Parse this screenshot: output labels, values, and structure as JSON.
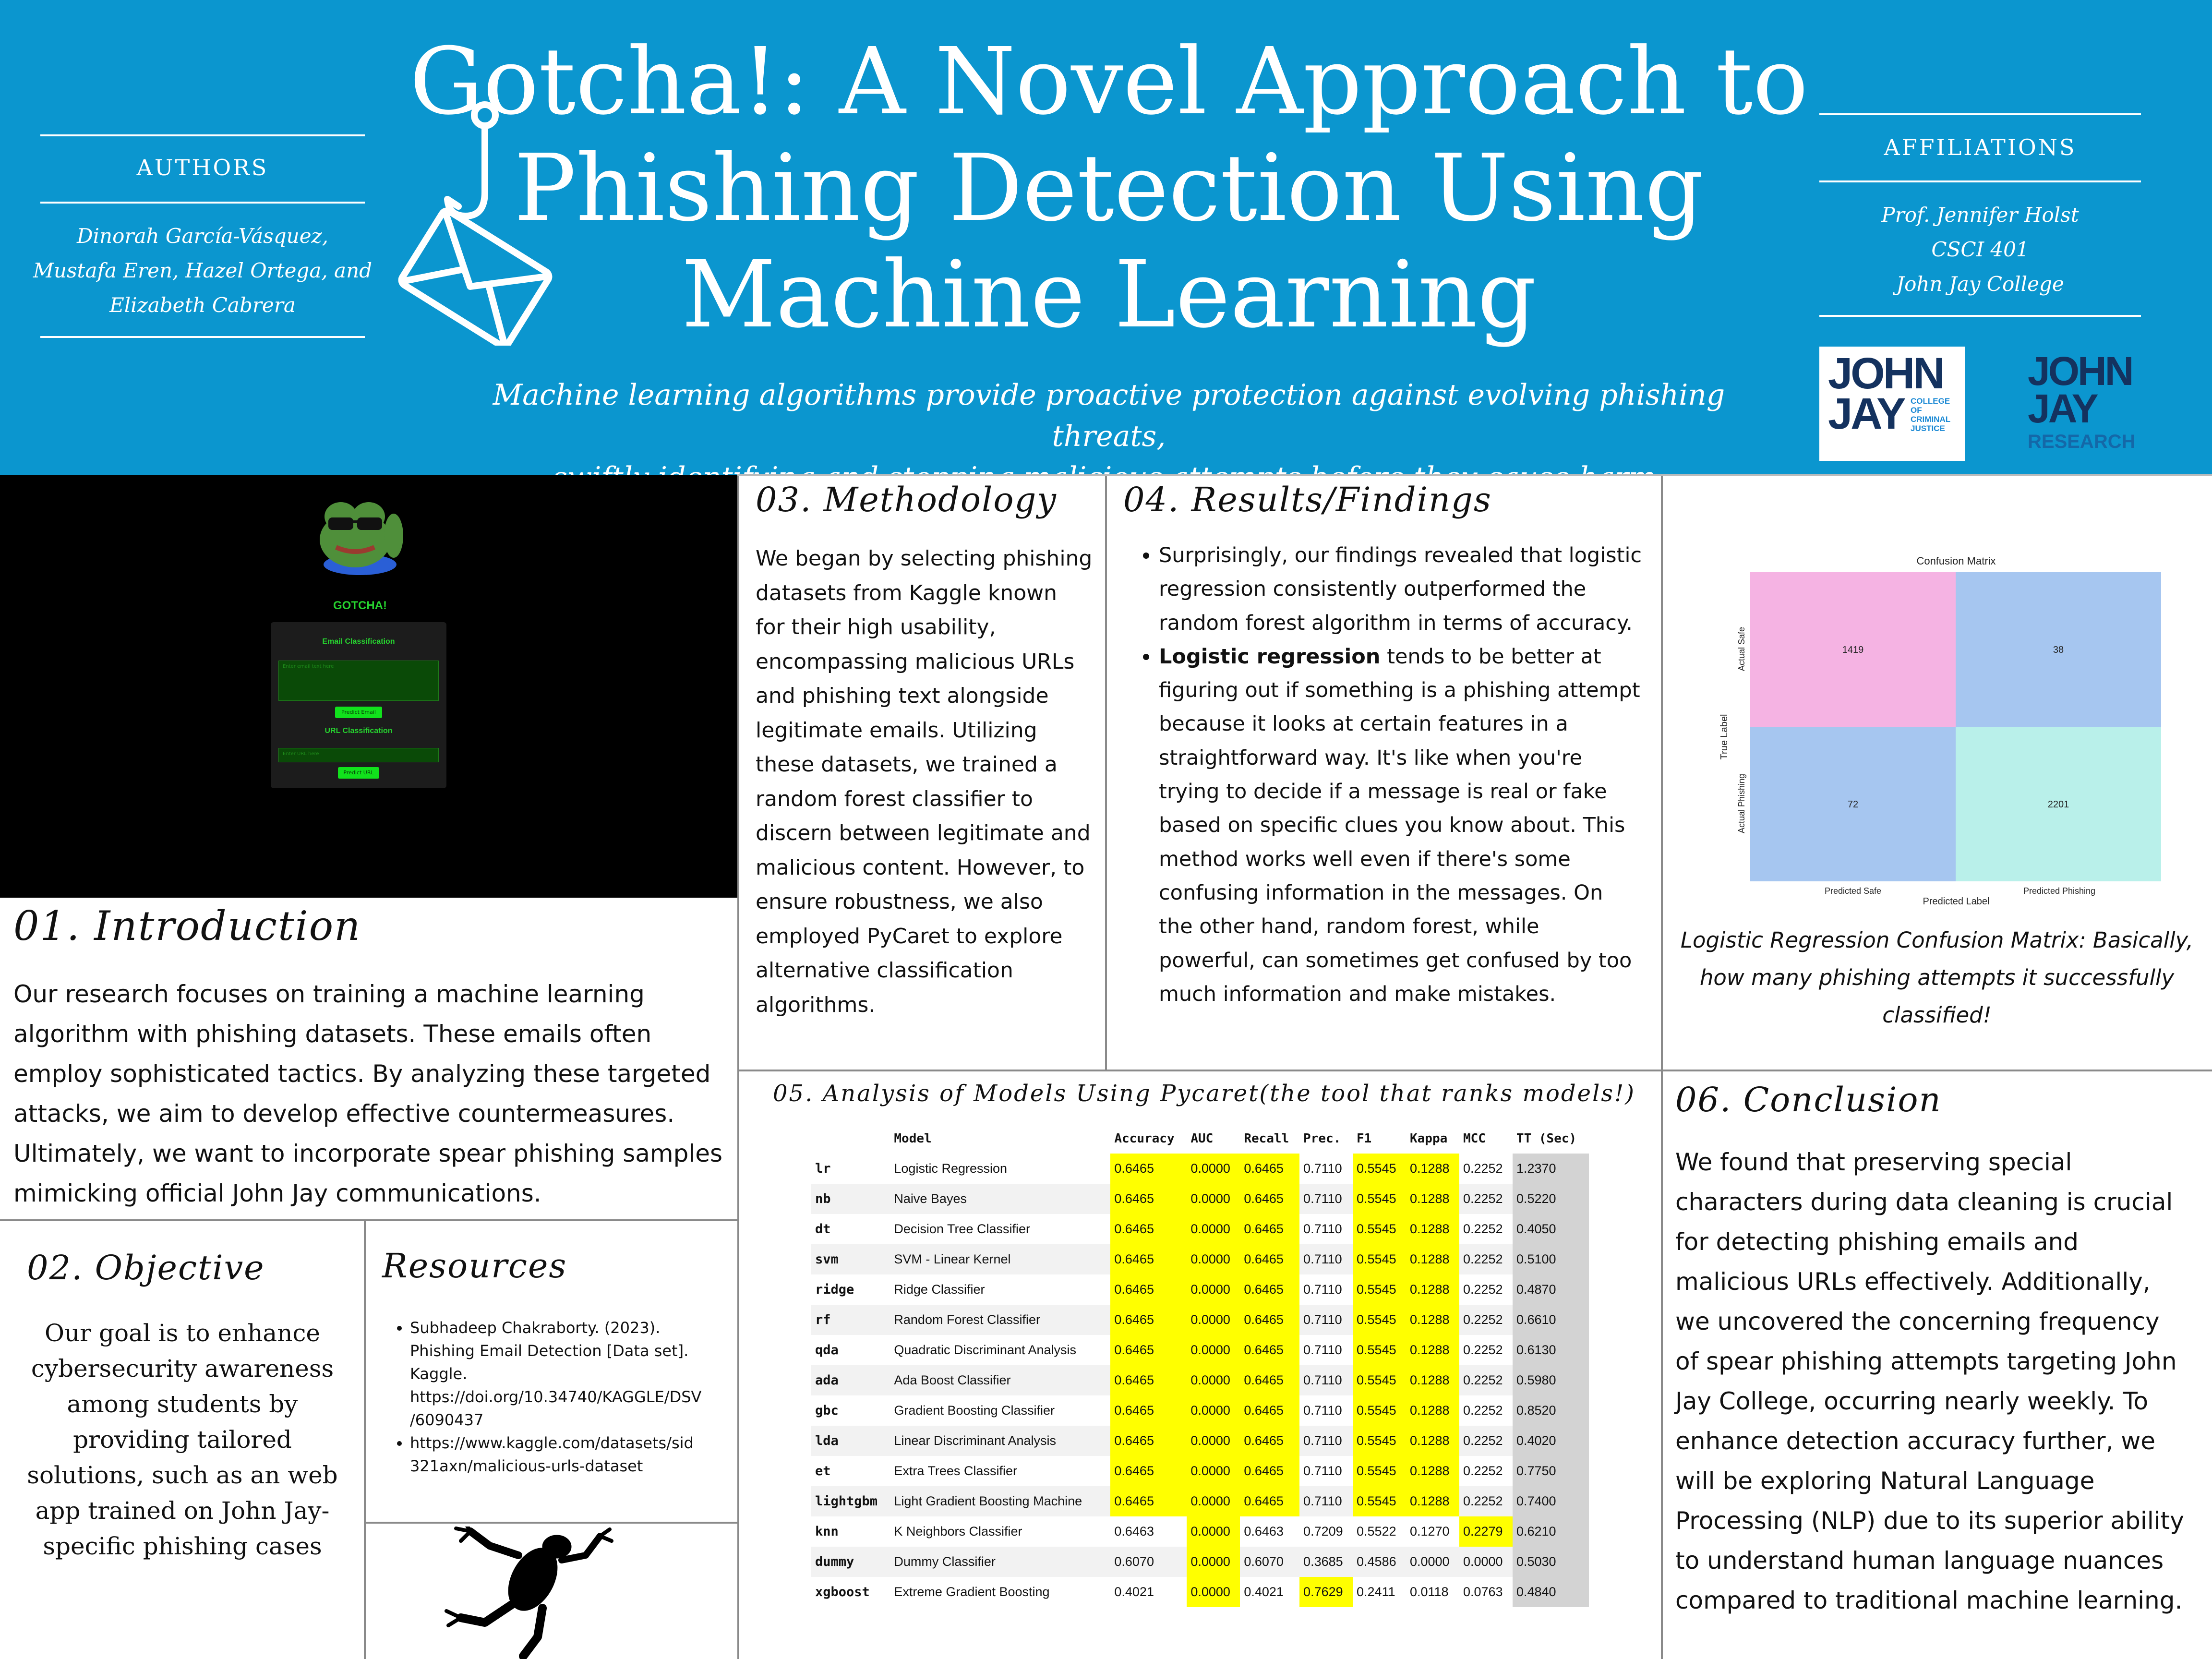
{
  "header": {
    "title_lines": [
      "Gotcha!: A Novel Approach to",
      "Phishing Detection Using",
      "Machine Learning"
    ],
    "tagline_lines": [
      "Machine learning algorithms provide proactive protection against evolving phishing threats,",
      "swiftly identifying and stopping malicious attempts before they cause harm."
    ],
    "authors_label": "AUTHORS",
    "authors_lines": [
      "Dinorah García-Vásquez,",
      "Mustafa Eren, Hazel Ortega, and",
      "Elizabeth Cabrera"
    ],
    "affiliations_label": "AFFILIATIONS",
    "affiliations_lines": [
      "Prof. Jennifer Holst",
      "CSCI 401",
      "John Jay College"
    ],
    "logo1": {
      "line1": "JOHN",
      "line2": "JAY",
      "sub": [
        "COLLEGE",
        "OF",
        "CRIMINAL",
        "JUSTICE"
      ]
    },
    "logo2": {
      "line1": "JOHN",
      "line2": "JAY",
      "sub": "RESEARCH"
    },
    "icon": "phishing-hook-envelope-icon"
  },
  "app_mockup": {
    "brand": "GOTCHA!",
    "email_heading": "Email Classification",
    "email_placeholder": "Enter email text here",
    "email_button": "Predict Email",
    "url_heading": "URL Classification",
    "url_placeholder": "Enter URL here",
    "url_button": "Predict URL",
    "mascot": "frog-with-sunglasses-icon"
  },
  "introduction": {
    "title": "01. Introduction",
    "lines": [
      "Our research focuses on training a machine learning",
      "algorithm with phishing datasets. These emails often",
      "employ sophisticated tactics. By analyzing these targeted",
      "attacks, we aim to develop effective countermeasures.",
      "Ultimately, we want to incorporate spear phishing samples",
      "mimicking official John Jay communications."
    ]
  },
  "objective": {
    "title": "02. Objective",
    "lines": [
      "Our goal is to enhance",
      "cybersecurity awareness",
      "among students by",
      "providing tailored",
      "solutions, such as an web",
      "app trained on John Jay-",
      "specific phishing cases"
    ]
  },
  "resources": {
    "title": "Resources",
    "items": [
      [
        "Subhadeep Chakraborty. (2023).",
        "Phishing Email Detection [Data set].",
        "Kaggle.",
        "https://doi.org/10.34740/KAGGLE/DSV",
        "/6090437"
      ],
      [
        "https://www.kaggle.com/datasets/sid",
        "321axn/malicious-urls-dataset"
      ]
    ],
    "decoration": "frog-silhouette-icon"
  },
  "methodology": {
    "title": "03. Methodology",
    "lines": [
      "We began by selecting phishing",
      "datasets from Kaggle known",
      "for their high usability,",
      "encompassing malicious URLs",
      "and phishing text alongside",
      "legitimate emails. Utilizing",
      "these datasets, we trained a",
      "random forest classifier to",
      "discern between legitimate and",
      "malicious content. However, to",
      "ensure robustness, we also",
      "employed PyCaret to explore",
      "alternative classification",
      "algorithms."
    ]
  },
  "results": {
    "title": "04. Results/Findings",
    "bullet1": [
      "Surprisingly, our findings revealed that logistic",
      "regression consistently outperformed the",
      "random forest algorithm in terms of accuracy."
    ],
    "bullet2_bold": "Logistic regression",
    "bullet2_first_rest": " tends to be better at",
    "bullet2": [
      "figuring out if something is a phishing attempt",
      "because it looks at certain features in a",
      "straightforward way. It's like when you're",
      "trying to decide if a message is real or fake",
      "based on specific clues you know about. This",
      "method works well even if there's some",
      "confusing information in the messages. On",
      "the other hand, random forest, while",
      "powerful, can sometimes get confused by too",
      "much information and make mistakes."
    ]
  },
  "confusion": {
    "caption_lines": [
      "Logistic Regression Confusion Matrix: Basically,",
      "how many phishing attempts it successfully",
      "classified!"
    ]
  },
  "chart_data": {
    "type": "heatmap",
    "title": "Confusion Matrix",
    "xlabel": "Predicted Label",
    "ylabel": "True Label",
    "x_categories": [
      "Predicted Safe",
      "Predicted Phishing"
    ],
    "y_categories": [
      "Actual Safe",
      "Actual Phishing"
    ],
    "values": [
      [
        1419,
        38
      ],
      [
        72,
        2201
      ]
    ],
    "colors": [
      [
        "#f5b3e3",
        "#a6c6f0"
      ],
      [
        "#a6c6f0",
        "#b9f0ea"
      ]
    ]
  },
  "analysis": {
    "title": "05. Analysis of Models Using Pycaret(the tool that ranks models!)",
    "headers": [
      "",
      "Model",
      "Accuracy",
      "AUC",
      "Recall",
      "Prec.",
      "F1",
      "Kappa",
      "MCC",
      "TT (Sec)"
    ],
    "rows": [
      [
        "lr",
        "Logistic Regression",
        "0.6465",
        "0.0000",
        "0.6465",
        "0.7110",
        "0.5545",
        "0.1288",
        "0.2252",
        "1.2370"
      ],
      [
        "nb",
        "Naive Bayes",
        "0.6465",
        "0.0000",
        "0.6465",
        "0.7110",
        "0.5545",
        "0.1288",
        "0.2252",
        "0.5220"
      ],
      [
        "dt",
        "Decision Tree Classifier",
        "0.6465",
        "0.0000",
        "0.6465",
        "0.7110",
        "0.5545",
        "0.1288",
        "0.2252",
        "0.4050"
      ],
      [
        "svm",
        "SVM - Linear Kernel",
        "0.6465",
        "0.0000",
        "0.6465",
        "0.7110",
        "0.5545",
        "0.1288",
        "0.2252",
        "0.5100"
      ],
      [
        "ridge",
        "Ridge Classifier",
        "0.6465",
        "0.0000",
        "0.6465",
        "0.7110",
        "0.5545",
        "0.1288",
        "0.2252",
        "0.4870"
      ],
      [
        "rf",
        "Random Forest Classifier",
        "0.6465",
        "0.0000",
        "0.6465",
        "0.7110",
        "0.5545",
        "0.1288",
        "0.2252",
        "0.6610"
      ],
      [
        "qda",
        "Quadratic Discriminant Analysis",
        "0.6465",
        "0.0000",
        "0.6465",
        "0.7110",
        "0.5545",
        "0.1288",
        "0.2252",
        "0.6130"
      ],
      [
        "ada",
        "Ada Boost Classifier",
        "0.6465",
        "0.0000",
        "0.6465",
        "0.7110",
        "0.5545",
        "0.1288",
        "0.2252",
        "0.5980"
      ],
      [
        "gbc",
        "Gradient Boosting Classifier",
        "0.6465",
        "0.0000",
        "0.6465",
        "0.7110",
        "0.5545",
        "0.1288",
        "0.2252",
        "0.8520"
      ],
      [
        "lda",
        "Linear Discriminant Analysis",
        "0.6465",
        "0.0000",
        "0.6465",
        "0.7110",
        "0.5545",
        "0.1288",
        "0.2252",
        "0.4020"
      ],
      [
        "et",
        "Extra Trees Classifier",
        "0.6465",
        "0.0000",
        "0.6465",
        "0.7110",
        "0.5545",
        "0.1288",
        "0.2252",
        "0.7750"
      ],
      [
        "lightgbm",
        "Light Gradient Boosting Machine",
        "0.6465",
        "0.0000",
        "0.6465",
        "0.7110",
        "0.5545",
        "0.1288",
        "0.2252",
        "0.7400"
      ],
      [
        "knn",
        "K Neighbors Classifier",
        "0.6463",
        "0.0000",
        "0.6463",
        "0.7209",
        "0.5522",
        "0.1270",
        "0.2279",
        "0.6210"
      ],
      [
        "dummy",
        "Dummy Classifier",
        "0.6070",
        "0.0000",
        "0.6070",
        "0.3685",
        "0.4586",
        "0.0000",
        "0.0000",
        "0.5030"
      ],
      [
        "xgboost",
        "Extreme Gradient Boosting",
        "0.4021",
        "0.0000",
        "0.4021",
        "0.7629",
        "0.2411",
        "0.0118",
        "0.0763",
        "0.4840"
      ]
    ],
    "highlight_color": "#ffff00",
    "tt_color": "#d3d3d3"
  },
  "conclusion": {
    "title": "06. Conclusion",
    "lines": [
      "We found that preserving special",
      "characters during data cleaning is crucial",
      "for detecting phishing emails and",
      "malicious URLs effectively. Additionally,",
      "we uncovered the concerning frequency",
      "of spear phishing attempts targeting John",
      "Jay College, occurring nearly weekly. To",
      "enhance detection accuracy further, we",
      "will be exploring Natural Language",
      "Processing (NLP) due to its superior ability",
      "to understand human language nuances",
      "compared to traditional machine learning."
    ]
  }
}
